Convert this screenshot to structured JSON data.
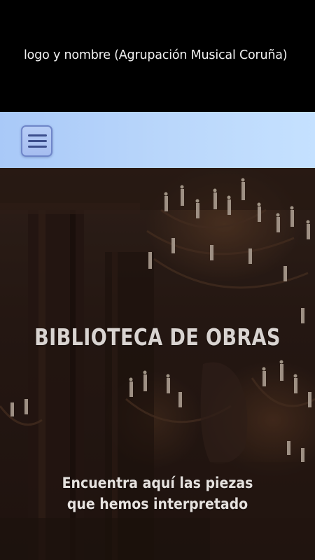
{
  "header": {
    "logo_text": "logo y nombre (Agrupación Musical Coruña)"
  },
  "navbar": {
    "menu_icon": "hamburger-menu-icon"
  },
  "hero": {
    "title": "BIBLIOTECA DE OBRAS",
    "subtitle_line1": "Encuentra aquí las piezas",
    "subtitle_line2": "que hemos interpretado",
    "background": "opera-hall-chandelier-photo"
  },
  "colors": {
    "header_bg": "#000000",
    "navbar_gradient_start": "#a9c9f8",
    "navbar_gradient_end": "#c5e1ff",
    "menu_bar": "#3c4e8c",
    "hero_text": "#d9d4d1"
  }
}
